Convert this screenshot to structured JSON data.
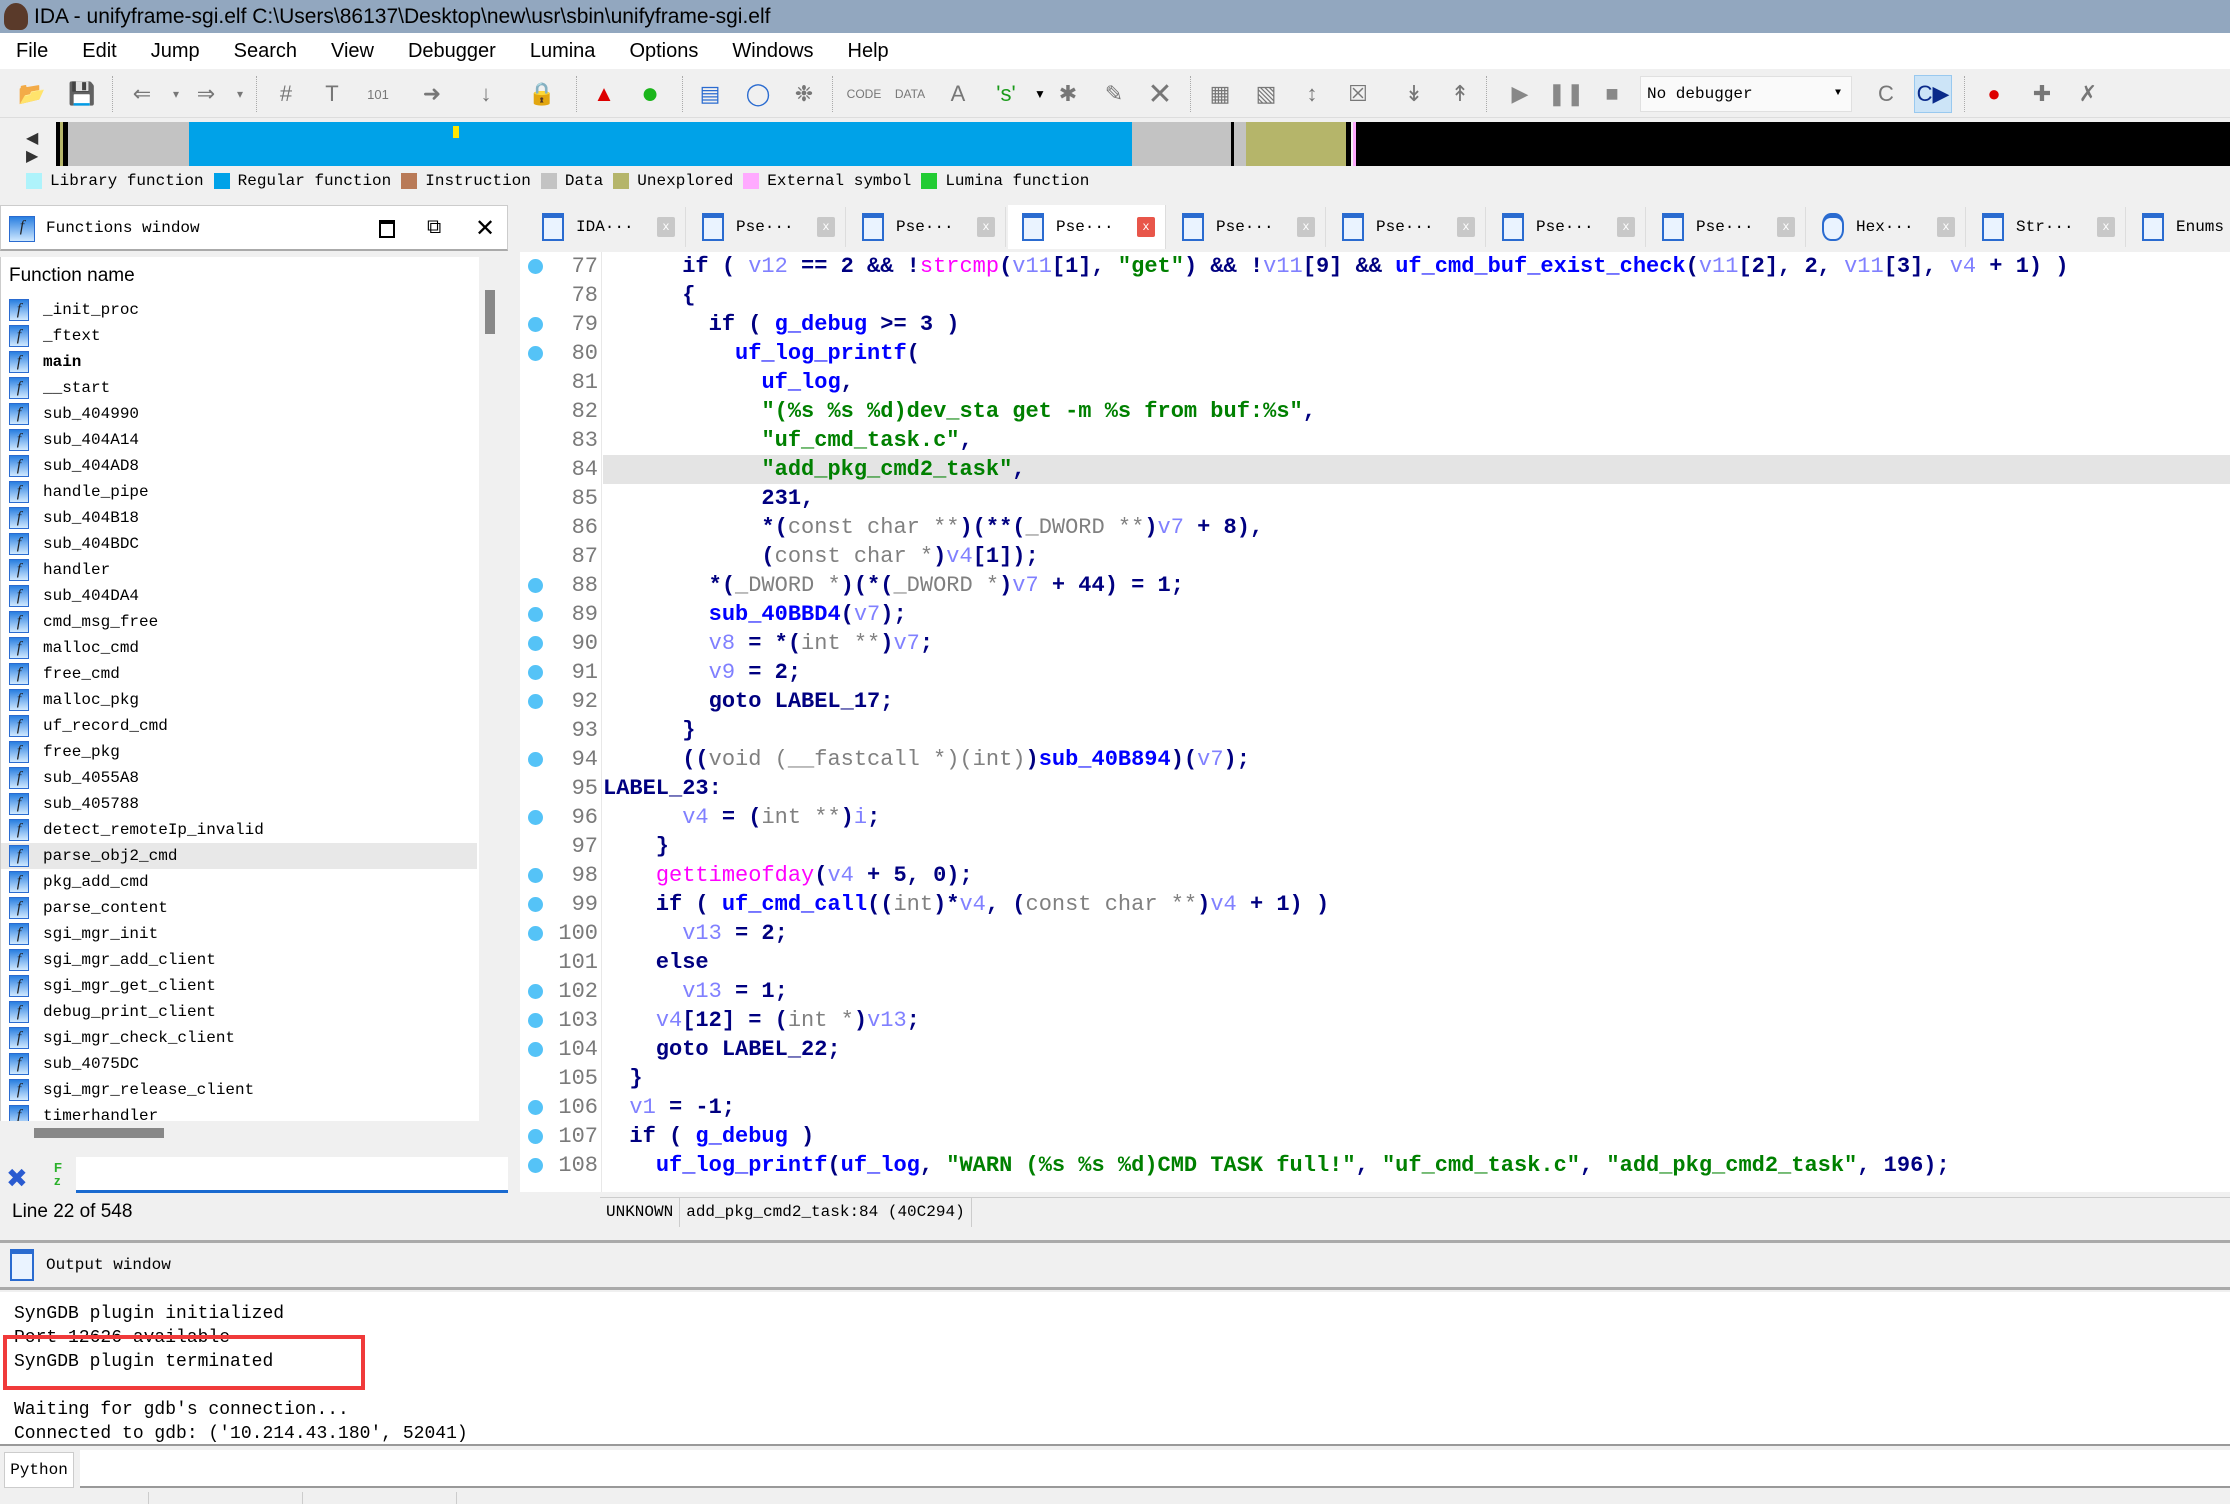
{
  "window": {
    "title": "IDA - unifyframe-sgi.elf C:\\Users\\86137\\Desktop\\new\\usr\\sbin\\unifyframe-sgi.elf"
  },
  "menu": [
    "File",
    "Edit",
    "Jump",
    "Search",
    "View",
    "Debugger",
    "Lumina",
    "Options",
    "Windows",
    "Help"
  ],
  "toolbar": {
    "debugger_select": "No debugger"
  },
  "legend": [
    {
      "label": "Library function",
      "color": "#aef3fb"
    },
    {
      "label": "Regular function",
      "color": "#00a2e8"
    },
    {
      "label": "Instruction",
      "color": "#b97a57"
    },
    {
      "label": "Data",
      "color": "#c3c3c3"
    },
    {
      "label": "Unexplored",
      "color": "#b5b56a"
    },
    {
      "label": "External symbol",
      "color": "#ffaaff"
    },
    {
      "label": "Lumina function",
      "color": "#22cc33"
    }
  ],
  "functions_window": {
    "title": "Functions window",
    "column": "Function name",
    "selected": "parse_obj2_cmd",
    "items": [
      "_init_proc",
      "_ftext",
      "main",
      "__start",
      "sub_404990",
      "sub_404A14",
      "sub_404AD8",
      "handle_pipe",
      "sub_404B18",
      "sub_404BDC",
      "handler",
      "sub_404DA4",
      "cmd_msg_free",
      "malloc_cmd",
      "free_cmd",
      "malloc_pkg",
      "uf_record_cmd",
      "free_pkg",
      "sub_4055A8",
      "sub_405788",
      "detect_remoteIp_invalid",
      "parse_obj2_cmd",
      "pkg_add_cmd",
      "parse_content",
      "sgi_mgr_init",
      "sgi_mgr_add_client",
      "sgi_mgr_get_client",
      "debug_print_client",
      "sgi_mgr_check_client",
      "sub_4075DC",
      "sgi_mgr_release_client",
      "timerhandler"
    ],
    "filter_value": "",
    "line_status": "Line 22 of 548"
  },
  "tabs": [
    {
      "label": "IDA···",
      "icon": "doc-icon"
    },
    {
      "label": "Pse···",
      "icon": "doc-icon"
    },
    {
      "label": "Pse···",
      "icon": "doc-icon"
    },
    {
      "label": "Pse···",
      "icon": "doc-icon",
      "active": true
    },
    {
      "label": "Pse···",
      "icon": "doc-icon"
    },
    {
      "label": "Pse···",
      "icon": "doc-icon"
    },
    {
      "label": "Pse···",
      "icon": "doc-icon"
    },
    {
      "label": "Pse···",
      "icon": "doc-icon"
    },
    {
      "label": "Hex···",
      "icon": "hex-icon"
    },
    {
      "label": "Str···",
      "icon": "strings-icon"
    },
    {
      "label": "Enums",
      "icon": "enums-icon"
    }
  ],
  "code": {
    "highlight_line": 84,
    "lines": [
      {
        "n": 77,
        "dot": true,
        "t": [
          [
            "n",
            "      if ( "
          ],
          [
            "v",
            "v12"
          ],
          [
            "n",
            " == 2 && !"
          ],
          [
            "m",
            "strcmp"
          ],
          [
            "n",
            "("
          ],
          [
            "v",
            "v11"
          ],
          [
            "n",
            "[1], "
          ],
          [
            "s",
            "\"get\""
          ],
          [
            "n",
            ") && !"
          ],
          [
            "v",
            "v11"
          ],
          [
            "n",
            "[9] && "
          ],
          [
            "f",
            "uf_cmd_buf_exist_check"
          ],
          [
            "n",
            "("
          ],
          [
            "v",
            "v11"
          ],
          [
            "n",
            "[2], 2, "
          ],
          [
            "v",
            "v11"
          ],
          [
            "n",
            "[3], "
          ],
          [
            "v",
            "v4"
          ],
          [
            "n",
            " + 1) )"
          ]
        ]
      },
      {
        "n": 78,
        "dot": false,
        "t": [
          [
            "n",
            "      {"
          ]
        ]
      },
      {
        "n": 79,
        "dot": true,
        "t": [
          [
            "n",
            "        if ( "
          ],
          [
            "f",
            "g_debug"
          ],
          [
            "n",
            " >= 3 )"
          ]
        ]
      },
      {
        "n": 80,
        "dot": true,
        "t": [
          [
            "n",
            "          "
          ],
          [
            "f",
            "uf_log_printf"
          ],
          [
            "n",
            "("
          ]
        ]
      },
      {
        "n": 81,
        "dot": false,
        "t": [
          [
            "n",
            "            "
          ],
          [
            "f",
            "uf_log"
          ],
          [
            "n",
            ","
          ]
        ]
      },
      {
        "n": 82,
        "dot": false,
        "t": [
          [
            "n",
            "            "
          ],
          [
            "s",
            "\"(%s %s %d)dev_sta get -m %s from buf:%s\""
          ],
          [
            "n",
            ","
          ]
        ]
      },
      {
        "n": 83,
        "dot": false,
        "t": [
          [
            "n",
            "            "
          ],
          [
            "s",
            "\"uf_cmd_task.c\""
          ],
          [
            "n",
            ","
          ]
        ]
      },
      {
        "n": 84,
        "dot": false,
        "t": [
          [
            "n",
            "            "
          ],
          [
            "s",
            "\"add_pkg_cmd2_task\""
          ],
          [
            "n",
            ","
          ]
        ]
      },
      {
        "n": 85,
        "dot": false,
        "t": [
          [
            "n",
            "            231,"
          ]
        ]
      },
      {
        "n": 86,
        "dot": false,
        "t": [
          [
            "n",
            "            *("
          ],
          [
            "t",
            "const char **"
          ],
          [
            "n",
            ")(**("
          ],
          [
            "t",
            "_DWORD **"
          ],
          [
            "n",
            ")"
          ],
          [
            "v",
            "v7"
          ],
          [
            "n",
            " + 8),"
          ]
        ]
      },
      {
        "n": 87,
        "dot": false,
        "t": [
          [
            "n",
            "            ("
          ],
          [
            "t",
            "const char *"
          ],
          [
            "n",
            ")"
          ],
          [
            "v",
            "v4"
          ],
          [
            "n",
            "[1]);"
          ]
        ]
      },
      {
        "n": 88,
        "dot": true,
        "t": [
          [
            "n",
            "        *("
          ],
          [
            "t",
            "_DWORD *"
          ],
          [
            "n",
            ")(*("
          ],
          [
            "t",
            "_DWORD *"
          ],
          [
            "n",
            ")"
          ],
          [
            "v",
            "v7"
          ],
          [
            "n",
            " + 44) = 1;"
          ]
        ]
      },
      {
        "n": 89,
        "dot": true,
        "t": [
          [
            "n",
            "        "
          ],
          [
            "f",
            "sub_40BBD4"
          ],
          [
            "n",
            "("
          ],
          [
            "v",
            "v7"
          ],
          [
            "n",
            ");"
          ]
        ]
      },
      {
        "n": 90,
        "dot": true,
        "t": [
          [
            "n",
            "        "
          ],
          [
            "v",
            "v8"
          ],
          [
            "n",
            " = *("
          ],
          [
            "t",
            "int **"
          ],
          [
            "n",
            ")"
          ],
          [
            "v",
            "v7"
          ],
          [
            "n",
            ";"
          ]
        ]
      },
      {
        "n": 91,
        "dot": true,
        "t": [
          [
            "n",
            "        "
          ],
          [
            "v",
            "v9"
          ],
          [
            "n",
            " = 2;"
          ]
        ]
      },
      {
        "n": 92,
        "dot": true,
        "t": [
          [
            "n",
            "        goto LABEL_17;"
          ]
        ]
      },
      {
        "n": 93,
        "dot": false,
        "t": [
          [
            "n",
            "      }"
          ]
        ]
      },
      {
        "n": 94,
        "dot": true,
        "t": [
          [
            "n",
            "      (("
          ],
          [
            "t",
            "void (__fastcall *)(int)"
          ],
          [
            "n",
            ")"
          ],
          [
            "f",
            "sub_40B894"
          ],
          [
            "n",
            ")("
          ],
          [
            "v",
            "v7"
          ],
          [
            "n",
            ");"
          ]
        ]
      },
      {
        "n": 95,
        "dot": false,
        "t": [
          [
            "n",
            "LABEL_23:"
          ]
        ]
      },
      {
        "n": 96,
        "dot": true,
        "t": [
          [
            "n",
            "      "
          ],
          [
            "v",
            "v4"
          ],
          [
            "n",
            " = ("
          ],
          [
            "t",
            "int **"
          ],
          [
            "n",
            ")"
          ],
          [
            "v",
            "i"
          ],
          [
            "n",
            ";"
          ]
        ]
      },
      {
        "n": 97,
        "dot": false,
        "t": [
          [
            "n",
            "    }"
          ]
        ]
      },
      {
        "n": 98,
        "dot": true,
        "t": [
          [
            "n",
            "    "
          ],
          [
            "m",
            "gettimeofday"
          ],
          [
            "n",
            "("
          ],
          [
            "v",
            "v4"
          ],
          [
            "n",
            " + 5, 0);"
          ]
        ]
      },
      {
        "n": 99,
        "dot": true,
        "t": [
          [
            "n",
            "    if ( "
          ],
          [
            "f",
            "uf_cmd_call"
          ],
          [
            "n",
            "(("
          ],
          [
            "t",
            "int"
          ],
          [
            "n",
            ")*"
          ],
          [
            "v",
            "v4"
          ],
          [
            "n",
            ", ("
          ],
          [
            "t",
            "const char **"
          ],
          [
            "n",
            ")"
          ],
          [
            "v",
            "v4"
          ],
          [
            "n",
            " + 1) )"
          ]
        ]
      },
      {
        "n": 100,
        "dot": true,
        "t": [
          [
            "n",
            "      "
          ],
          [
            "v",
            "v13"
          ],
          [
            "n",
            " = 2;"
          ]
        ]
      },
      {
        "n": 101,
        "dot": false,
        "t": [
          [
            "n",
            "    else"
          ]
        ]
      },
      {
        "n": 102,
        "dot": true,
        "t": [
          [
            "n",
            "      "
          ],
          [
            "v",
            "v13"
          ],
          [
            "n",
            " = 1;"
          ]
        ]
      },
      {
        "n": 103,
        "dot": true,
        "t": [
          [
            "n",
            "    "
          ],
          [
            "v",
            "v4"
          ],
          [
            "n",
            "[12] = ("
          ],
          [
            "t",
            "int *"
          ],
          [
            "n",
            ")"
          ],
          [
            "v",
            "v13"
          ],
          [
            "n",
            ";"
          ]
        ]
      },
      {
        "n": 104,
        "dot": true,
        "t": [
          [
            "n",
            "    goto LABEL_22;"
          ]
        ]
      },
      {
        "n": 105,
        "dot": false,
        "t": [
          [
            "n",
            "  }"
          ]
        ]
      },
      {
        "n": 106,
        "dot": true,
        "t": [
          [
            "n",
            "  "
          ],
          [
            "v",
            "v1"
          ],
          [
            "n",
            " = -1;"
          ]
        ]
      },
      {
        "n": 107,
        "dot": true,
        "t": [
          [
            "n",
            "  if ( "
          ],
          [
            "f",
            "g_debug"
          ],
          [
            "n",
            " )"
          ]
        ]
      },
      {
        "n": 108,
        "dot": true,
        "t": [
          [
            "n",
            "    "
          ],
          [
            "f",
            "uf_log_printf"
          ],
          [
            "n",
            "("
          ],
          [
            "f",
            "uf_log"
          ],
          [
            "n",
            ", "
          ],
          [
            "s",
            "\"WARN (%s %s %d)CMD TASK full!\""
          ],
          [
            "n",
            ", "
          ],
          [
            "s",
            "\"uf_cmd_task.c\""
          ],
          [
            "n",
            ", "
          ],
          [
            "s",
            "\"add_pkg_cmd2_task\""
          ],
          [
            "n",
            ", 196);"
          ]
        ]
      }
    ],
    "status": {
      "mode": "UNKNOWN",
      "location": "add_pkg_cmd2_task:84 (40C294)"
    }
  },
  "output_window": {
    "title": "Output window",
    "lines": [
      "SynGDB plugin initialized",
      "Port 12626 available",
      "SynGDB plugin terminated",
      "",
      "Waiting for gdb's connection...",
      "Connected to gdb: ('10.214.43.180', 52041)"
    ],
    "highlighted": "SynGDB plugin terminated",
    "highlight_color": "#f03a3a"
  },
  "python_bar": {
    "label": "Python",
    "value": ""
  }
}
